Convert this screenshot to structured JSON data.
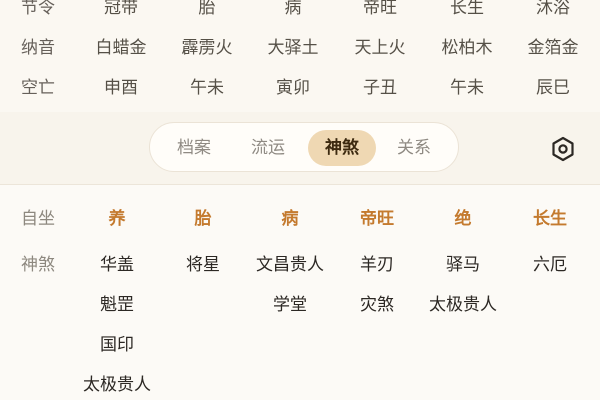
{
  "top_table": {
    "rows": [
      {
        "label": "节令",
        "cells": [
          "冠带",
          "胎",
          "病",
          "帝旺",
          "长生",
          "沐浴"
        ]
      },
      {
        "label": "纳音",
        "cells": [
          "白蜡金",
          "霹雳火",
          "大驿土",
          "天上火",
          "松柏木",
          "金箔金"
        ]
      },
      {
        "label": "空亡",
        "cells": [
          "申酉",
          "午未",
          "寅卯",
          "子丑",
          "午未",
          "辰巳"
        ]
      }
    ]
  },
  "tabs": [
    {
      "label": "档案",
      "active": false
    },
    {
      "label": "流运",
      "active": false
    },
    {
      "label": "神煞",
      "active": true
    },
    {
      "label": "关系",
      "active": false
    }
  ],
  "settings_icon": "hexagon-settings-icon",
  "lower_table": {
    "stage_row_label": "自坐",
    "stages": [
      "养",
      "胎",
      "病",
      "帝旺",
      "绝",
      "长生"
    ],
    "shensha_row_label": "神煞",
    "columns": [
      [
        "华盖",
        "魁罡",
        "国印",
        "太极贵人"
      ],
      [
        "将星"
      ],
      [
        "文昌贵人",
        "学堂"
      ],
      [
        "羊刃",
        "灾煞"
      ],
      [
        "驿马",
        "太极贵人"
      ],
      [
        "六厄"
      ]
    ]
  },
  "colors": {
    "background": "#fbf8f2",
    "active_tab_bg": "#efd8b3",
    "stage_text": "#c47a2e"
  }
}
